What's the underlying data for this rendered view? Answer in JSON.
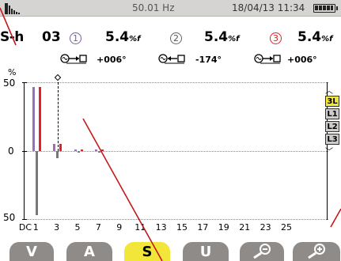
{
  "status": {
    "frequency": "50.01 Hz",
    "datetime": "18/04/13 11:34"
  },
  "header": {
    "mode": "S-h",
    "rank": "03",
    "phases": [
      {
        "number": "1",
        "value": "5.4",
        "unit": "%f",
        "circle_color": "#7b5aa8",
        "angle": "+006°",
        "icon": "source-to-load-icon"
      },
      {
        "number": "2",
        "value": "5.4",
        "unit": "%f",
        "circle_color": "#666666",
        "angle": "-174°",
        "icon": "load-to-source-icon"
      },
      {
        "number": "3",
        "value": "5.4",
        "unit": "%f",
        "circle_color": "#e0202a",
        "angle": "+006°",
        "icon": "source-to-load-icon"
      }
    ]
  },
  "chart_data": {
    "type": "bar",
    "y_unit": "%",
    "y_ticks": [
      "50",
      "0",
      "50"
    ],
    "ylim": [
      -50,
      50
    ],
    "x_labels": [
      "DC",
      "1",
      "3",
      "5",
      "7",
      "9",
      "11",
      "13",
      "15",
      "17",
      "19",
      "21",
      "23",
      "25"
    ],
    "cursor": "3",
    "series": [
      {
        "name": "1",
        "color": "#9b6fb8",
        "values": [
          {
            "h": 1,
            "v": 47
          },
          {
            "h": 3,
            "v": 5
          },
          {
            "h": 5,
            "v": 1
          },
          {
            "h": 7,
            "v": 1
          }
        ]
      },
      {
        "name": "2",
        "color": "#777777",
        "values": [
          {
            "h": 1,
            "v": -47
          },
          {
            "h": 3,
            "v": -5
          },
          {
            "h": 5,
            "v": -1
          },
          {
            "h": 7,
            "v": -1
          }
        ]
      },
      {
        "name": "3",
        "color": "#e0202a",
        "values": [
          {
            "h": 1,
            "v": 47
          },
          {
            "h": 3,
            "v": 5
          },
          {
            "h": 5,
            "v": 1
          },
          {
            "h": 7,
            "v": 1
          }
        ]
      }
    ]
  },
  "side_selector": {
    "items": [
      "3L",
      "L1",
      "L2",
      "L3"
    ],
    "active": "3L",
    "active_color": "#f3e63a"
  },
  "function_keys": {
    "v": "V",
    "a": "A",
    "s": "S",
    "u": "U",
    "active": "S",
    "zoom_out_icon": "zoom-out-icon",
    "zoom_in_icon": "zoom-in-icon"
  }
}
